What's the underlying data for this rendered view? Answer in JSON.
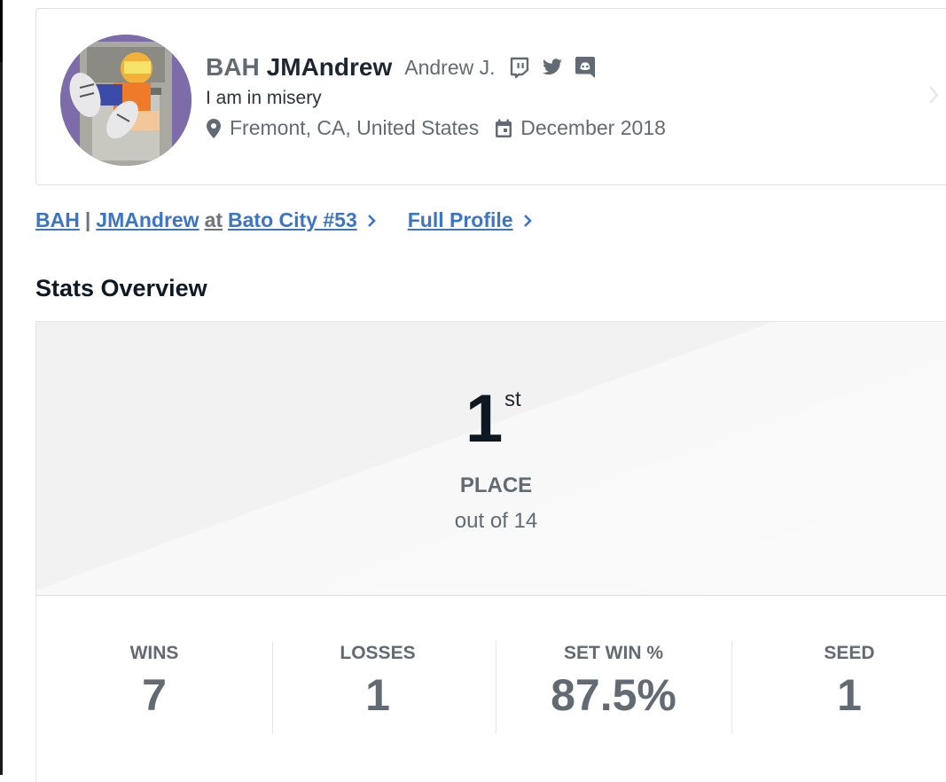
{
  "profile": {
    "prefix": "BAH",
    "gamertag": "JMAndrew",
    "real_name": "Andrew J.",
    "bio": "I am in misery",
    "location": "Fremont, CA, United States",
    "joined": "December 2018",
    "socials": [
      "twitch-icon",
      "twitter-icon",
      "discord-icon"
    ]
  },
  "links": {
    "entrant_prefix": "BAH",
    "entrant_sep": "|",
    "entrant_tag": "JMAndrew",
    "entrant_at": "at",
    "event": "Bato City #53",
    "full_profile": "Full Profile"
  },
  "section_title": "Stats Overview",
  "placement": {
    "number": "1",
    "suffix": "st",
    "label": "PLACE",
    "out_of": "out of 14"
  },
  "stats": [
    {
      "label": "WINS",
      "value": "7"
    },
    {
      "label": "LOSSES",
      "value": "1"
    },
    {
      "label": "SET WIN %",
      "value": "87.5%"
    },
    {
      "label": "SEED",
      "value": "1"
    }
  ],
  "colors": {
    "link": "#3b75c4",
    "muted": "#626b73",
    "dark": "#0e1822"
  }
}
